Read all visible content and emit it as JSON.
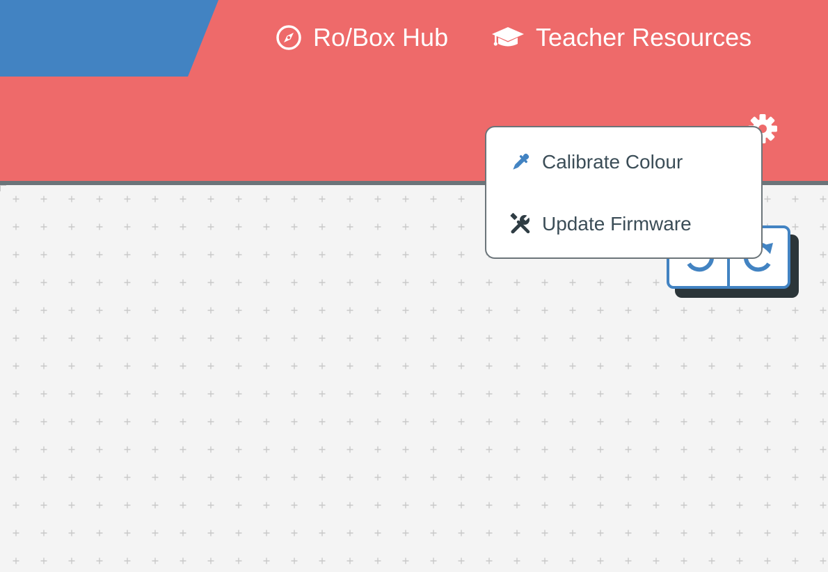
{
  "header": {
    "colors": {
      "background": "#ee6a6a",
      "logo_tab": "#4283c2",
      "divider": "#6b7479"
    },
    "nav": [
      {
        "label": "Ro/Box Hub",
        "icon": "compass-icon"
      },
      {
        "label": "Teacher Resources",
        "icon": "graduation-cap-icon"
      }
    ],
    "settings_icon": "gear-icon"
  },
  "settings_menu": {
    "items": [
      {
        "label": "Calibrate Colour",
        "icon": "eyedropper-icon"
      },
      {
        "label": "Update Firmware",
        "icon": "tools-icon"
      }
    ]
  },
  "workspace": {
    "background": "#f4f4f4",
    "grid_mark_color": "#c9c9c9"
  },
  "history": {
    "undo_icon": "undo-icon",
    "redo_icon": "redo-icon",
    "border_color": "#4283c2"
  }
}
